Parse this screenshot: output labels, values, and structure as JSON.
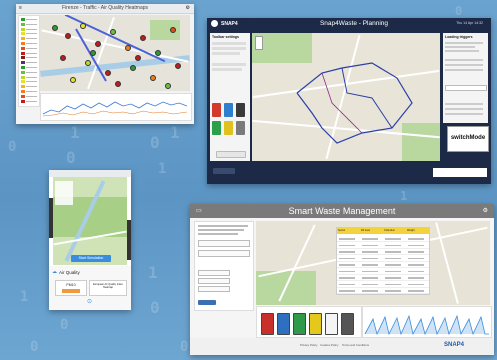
{
  "window1": {
    "title": "Firenze - Traffic - Air Quality Heatmaps",
    "legend_colors": [
      "#2e9b2e",
      "#67c23a",
      "#b5d92b",
      "#e8e22a",
      "#f3b41c",
      "#ef7d1b",
      "#e34b19",
      "#c41a1a",
      "#8b1a1a",
      "#5a2a7a",
      "#2e9b2e",
      "#67c23a",
      "#b5d92b",
      "#e8e22a",
      "#f3b41c",
      "#ef7d1b",
      "#e34b19",
      "#c41a1a"
    ]
  },
  "window2": {
    "title": "Snap4Waste - Planning",
    "logo": "SNAP4",
    "date": "Thu 14 Apr 14:32",
    "left_panel_title": "Toolbar settings",
    "right_panel_title": "Loading triggers",
    "switch_label": "switchMode",
    "bin_colors": [
      "#d23b2b",
      "#2f7fcf",
      "#3a3a3a",
      "#2aa04a",
      "#e0c21e",
      "#7a7a7a"
    ]
  },
  "window3": {
    "section_label": "Air Quality",
    "button": "Start Simulation",
    "metric1": "PM10",
    "metric2": "European Air Quality Index Heatmap"
  },
  "window4": {
    "title": "Smart Waste Management",
    "logo": "SNAP4",
    "footer_links": [
      "Privacy Policy",
      "Cookies Policy",
      "Terms and Conditions"
    ],
    "bin_colors": [
      "#c9302c",
      "#2f6fbf",
      "#2e9a4a",
      "#e4c91c",
      "#f4f4f4",
      "#555555"
    ],
    "table_headers": [
      "Sector",
      "Fill level",
      "Collection",
      "Weight"
    ]
  },
  "background_color": "#6aa3cf",
  "accent_dark": "#1c2a48"
}
